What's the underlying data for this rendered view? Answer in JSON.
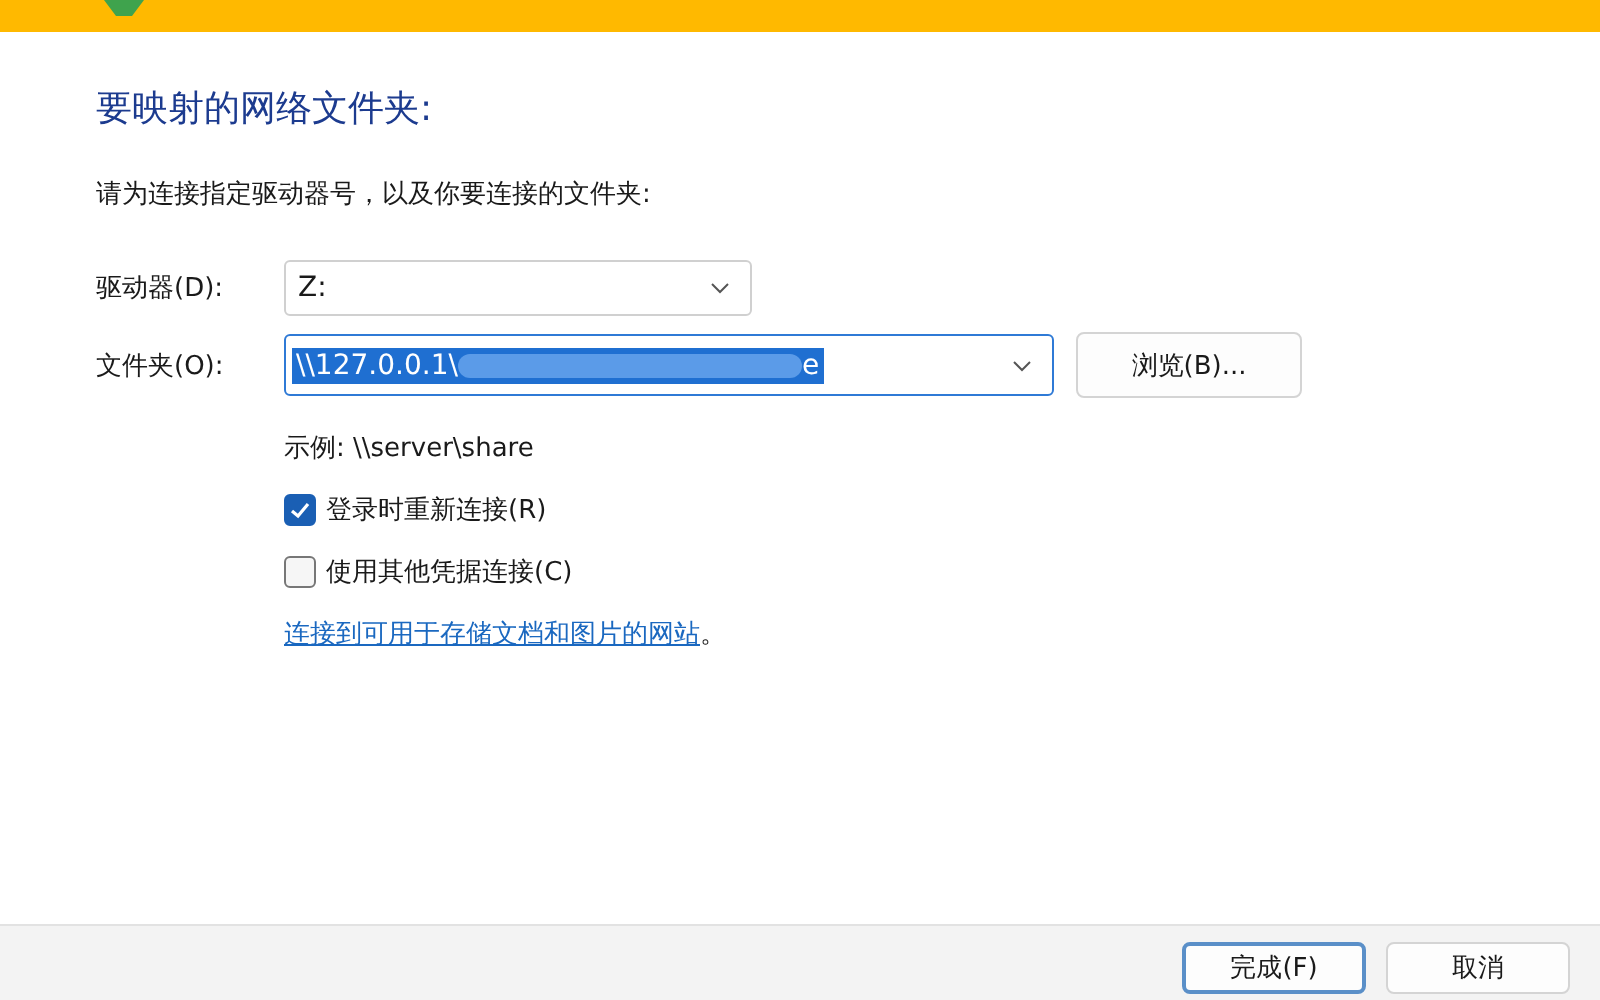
{
  "heading": "要映射的网络文件夹:",
  "instruction": "请为连接指定驱动器号，以及你要连接的文件夹:",
  "drive": {
    "label": "驱动器(D):",
    "value": "Z:"
  },
  "folder": {
    "label": "文件夹(O):",
    "value_start": "\\\\127.0.0.1\\",
    "value_end": "e",
    "selected": true
  },
  "browse_button": "浏览(B)...",
  "example": "示例: \\\\server\\share",
  "options": [
    {
      "label": "登录时重新连接(R)",
      "checked": true
    },
    {
      "label": "使用其他凭据连接(C)",
      "checked": false
    }
  ],
  "link": "连接到可用于存储文档和图片的网站",
  "link_suffix": "。",
  "buttons": [
    {
      "label": "完成(F)",
      "selected": true
    },
    {
      "label": "取消",
      "selected": false
    }
  ]
}
